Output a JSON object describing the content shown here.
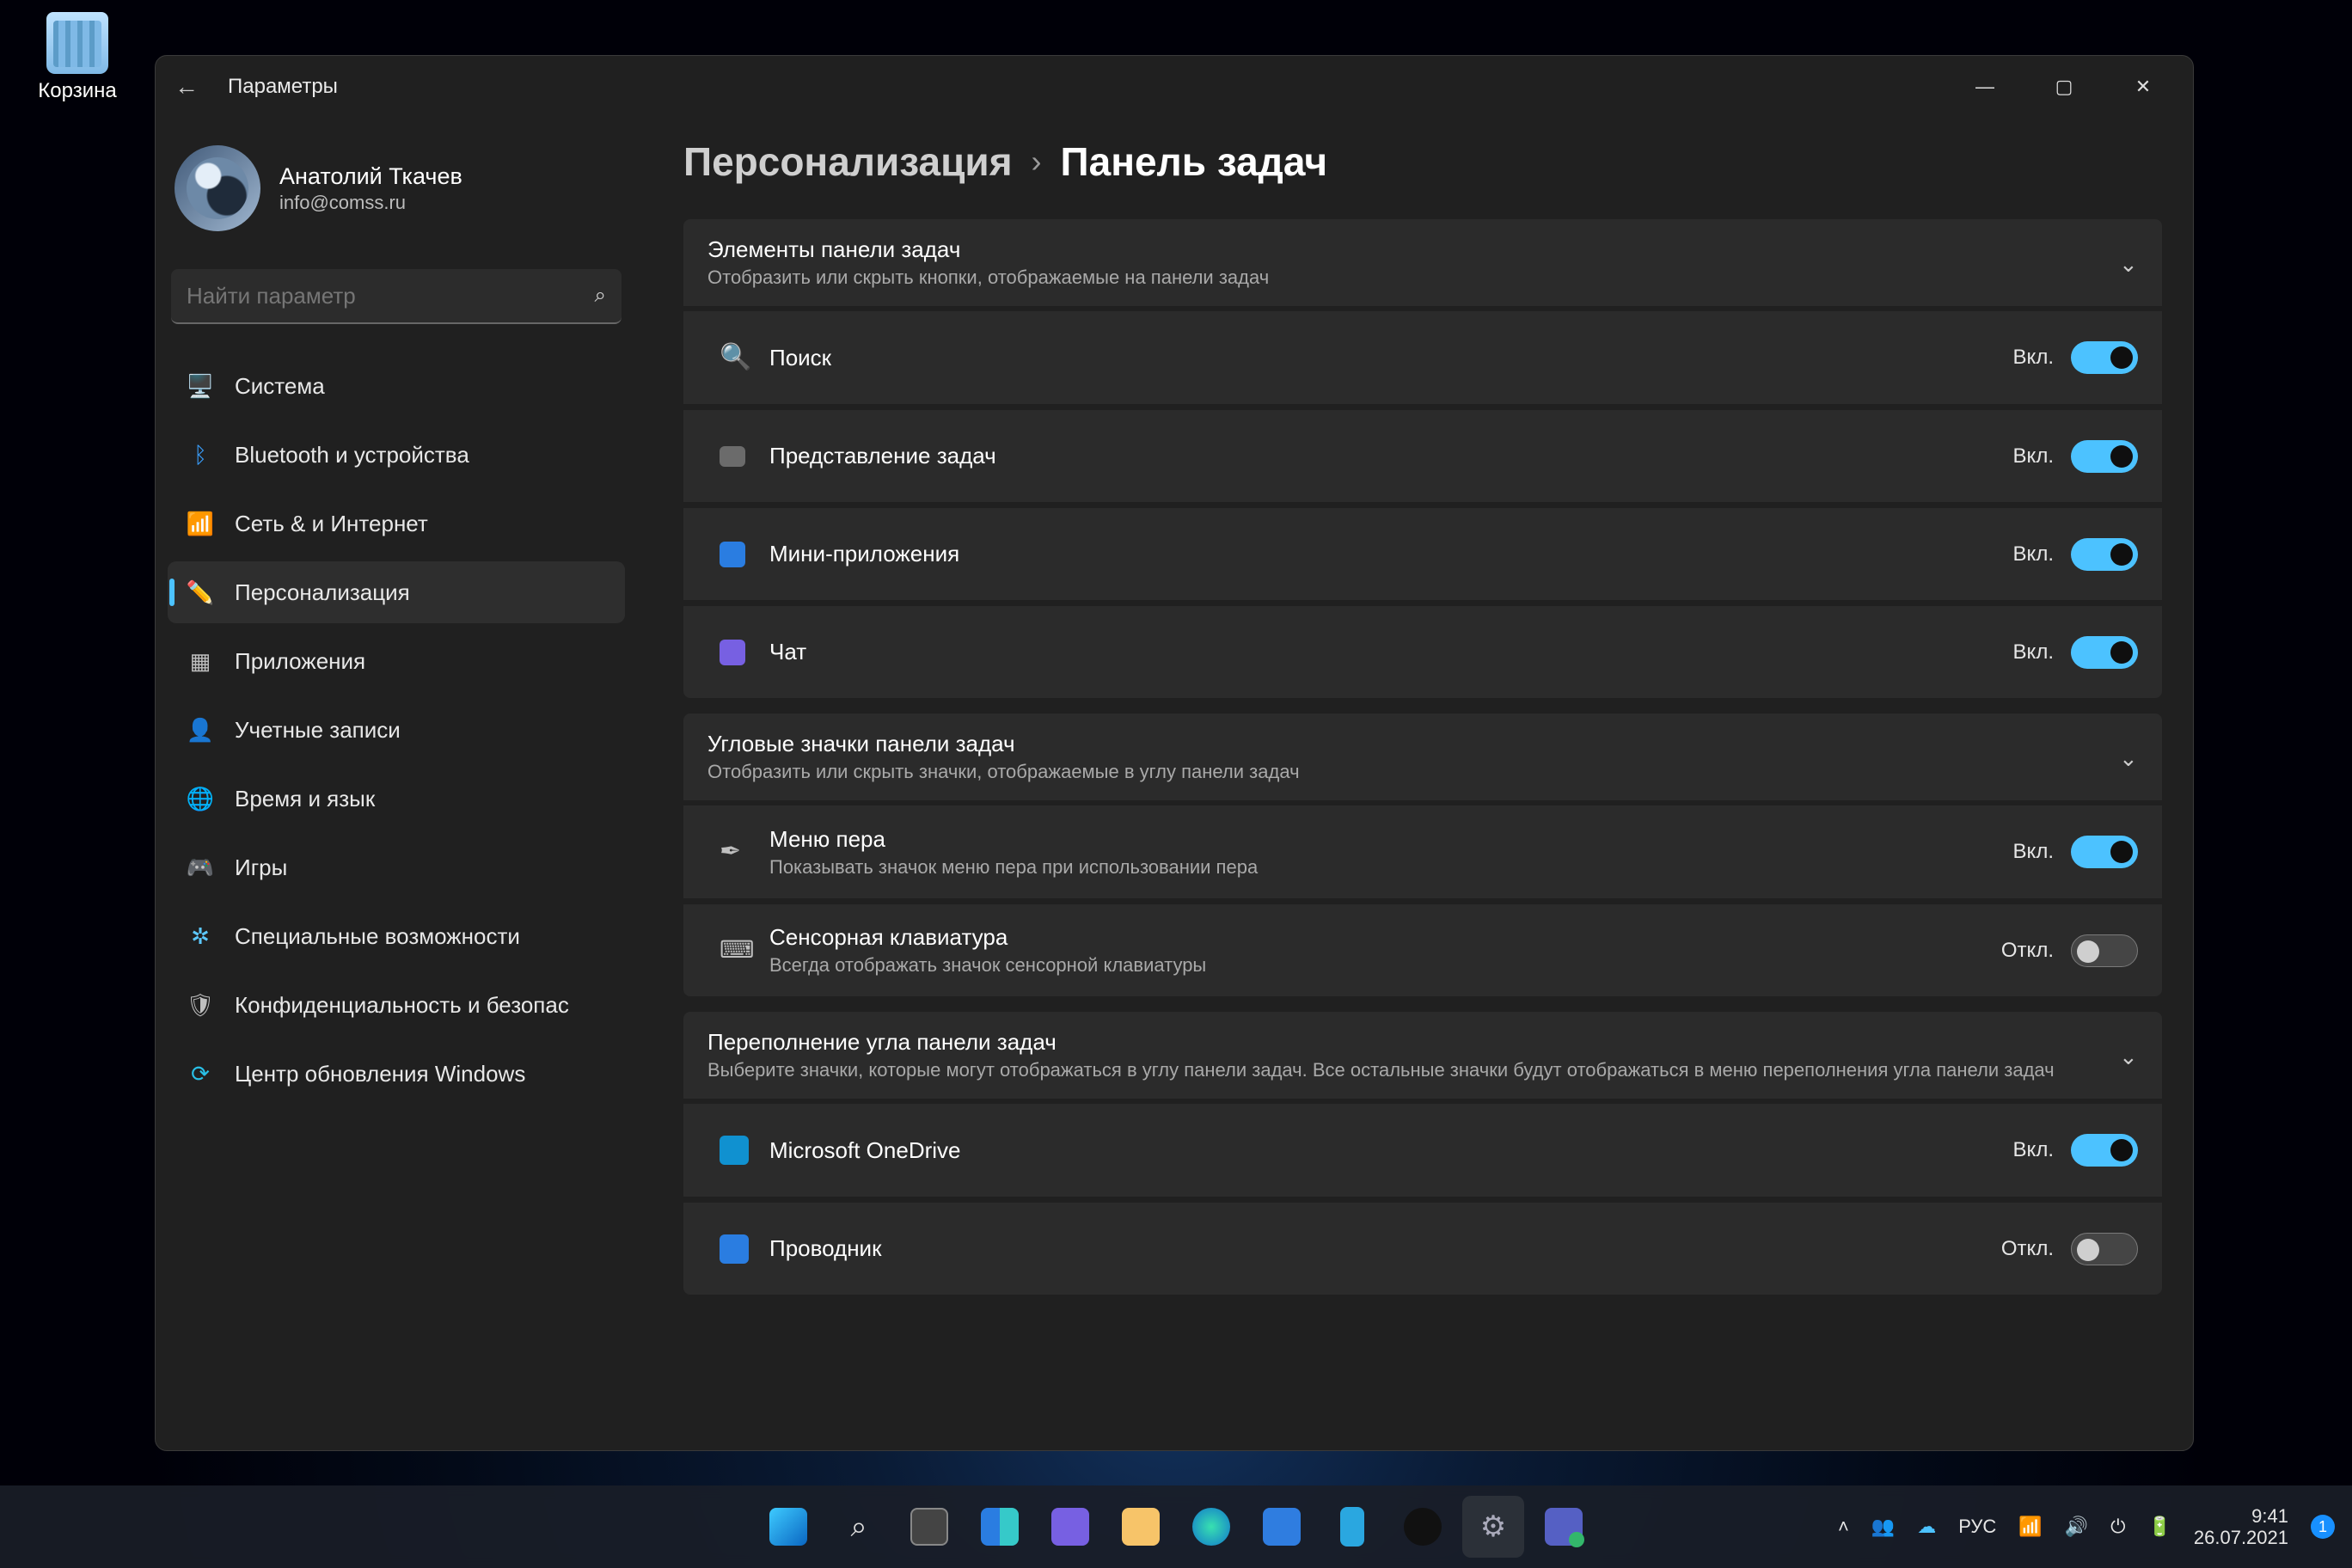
{
  "desktop": {
    "recycle_bin": "Корзина"
  },
  "window": {
    "title": "Параметры",
    "controls": {
      "min": "—",
      "max": "▢",
      "close": "✕"
    },
    "back": "←"
  },
  "profile": {
    "name": "Анатолий Ткачев",
    "email": "info@comss.ru"
  },
  "search": {
    "placeholder": "Найти параметр"
  },
  "sidebar": {
    "items": [
      {
        "label": "Система",
        "icon": "🖥️"
      },
      {
        "label": "Bluetooth и устройства",
        "icon": "ᛒ"
      },
      {
        "label": "Сеть & и Интернет",
        "icon": "📶"
      },
      {
        "label": "Персонализация",
        "icon": "✏️"
      },
      {
        "label": "Приложения",
        "icon": "▦"
      },
      {
        "label": "Учетные записи",
        "icon": "👤"
      },
      {
        "label": "Время и язык",
        "icon": "🌐"
      },
      {
        "label": "Игры",
        "icon": "🎮"
      },
      {
        "label": "Специальные возможности",
        "icon": "✲"
      },
      {
        "label": "Конфиденциальность и безопас",
        "icon": "🛡"
      },
      {
        "label": "Центр обновления Windows",
        "icon": "⟳"
      }
    ],
    "selected_index": 3
  },
  "breadcrumb": {
    "parent": "Персонализация",
    "sep": "›",
    "current": "Панель задач"
  },
  "state_labels": {
    "on": "Вкл.",
    "off": "Откл."
  },
  "sections": {
    "items": {
      "title": "Элементы панели задач",
      "subtitle": "Отобразить или скрыть кнопки, отображаемые на панели задач",
      "rows": [
        {
          "icon": "🔍",
          "label": "Поиск",
          "on": true
        },
        {
          "icon": "◧",
          "label": "Представление задач",
          "on": true
        },
        {
          "icon": "▥",
          "label": "Мини-приложения",
          "on": true
        },
        {
          "icon": "💬",
          "label": "Чат",
          "on": true
        }
      ]
    },
    "corner": {
      "title": "Угловые значки панели задач",
      "subtitle": "Отобразить или скрыть значки, отображаемые в углу панели задач",
      "rows": [
        {
          "icon": "✒",
          "label": "Меню пера",
          "sub": "Показывать значок меню пера при использовании пера",
          "on": true
        },
        {
          "icon": "⌨",
          "label": "Сенсорная клавиатура",
          "sub": "Всегда отображать значок сенсорной клавиатуры",
          "on": false
        }
      ]
    },
    "overflow": {
      "title": "Переполнение угла панели задач",
      "subtitle": "Выберите значки, которые могут отображаться в углу панели задач. Все остальные значки будут отображаться в меню переполнения угла панели задач",
      "rows": [
        {
          "icon": "☁",
          "label": "Microsoft OneDrive",
          "on": true
        },
        {
          "icon": "🖿",
          "label": "Проводник",
          "on": false
        }
      ]
    }
  },
  "taskbar": {
    "tray": {
      "lang": "РУС",
      "time": "9:41",
      "date": "26.07.2021",
      "notif": "1"
    }
  }
}
